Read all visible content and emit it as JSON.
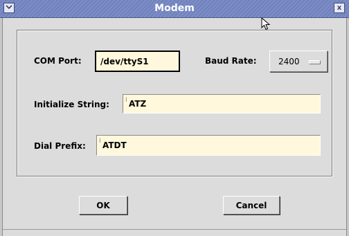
{
  "window": {
    "title": "Modem",
    "menu_icon": "chevron-down-icon",
    "close_icon": "close-icon",
    "close_glyph": "x"
  },
  "form": {
    "com_port": {
      "label": "COM Port:",
      "value": "/dev/ttyS1"
    },
    "baud_rate": {
      "label": "Baud Rate:",
      "value": "2400"
    },
    "init_string": {
      "label": "Initialize String:",
      "value": "ATZ"
    },
    "dial_prefix": {
      "label": "Dial Prefix:",
      "value": "ATDT"
    }
  },
  "buttons": {
    "ok": "OK",
    "cancel": "Cancel"
  },
  "colors": {
    "titlebar": "#7e8fc7",
    "field_bg": "#fff8dc",
    "window_bg": "#dcdcdc"
  }
}
